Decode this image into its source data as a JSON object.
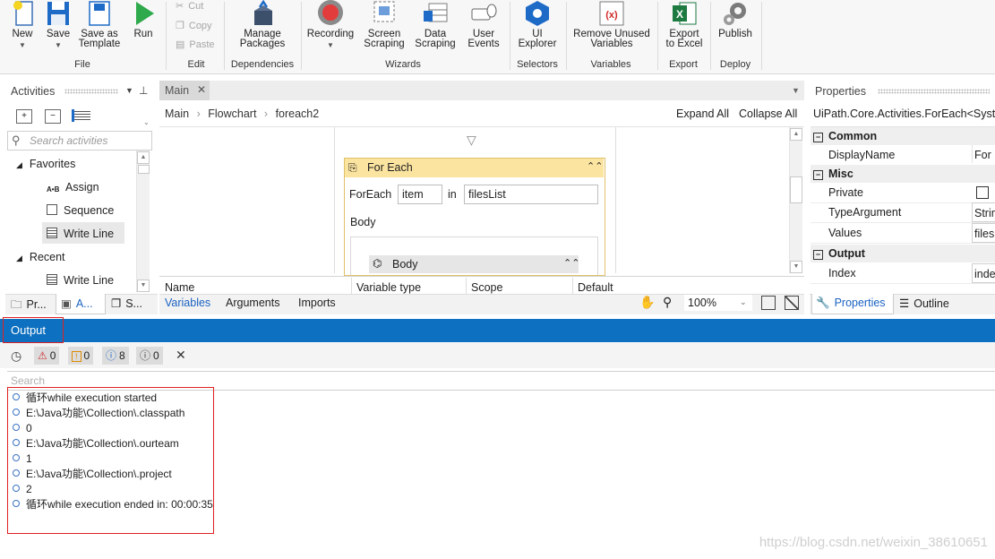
{
  "ribbon": {
    "buttons": {
      "new": "New",
      "save": "Save",
      "save_as_template_1": "Save as",
      "save_as_template_2": "Template",
      "run": "Run",
      "cut": "Cut",
      "copy": "Copy",
      "paste": "Paste",
      "manage_packages_1": "Manage",
      "manage_packages_2": "Packages",
      "recording": "Recording",
      "screen_scraping_1": "Screen",
      "screen_scraping_2": "Scraping",
      "data_scraping_1": "Data",
      "data_scraping_2": "Scraping",
      "user_events_1": "User",
      "user_events_2": "Events",
      "ui_explorer_1": "UI",
      "ui_explorer_2": "Explorer",
      "remove_unused_1": "Remove Unused",
      "remove_unused_2": "Variables",
      "export_excel_1": "Export",
      "export_excel_2": "to Excel",
      "publish": "Publish"
    },
    "groups": {
      "file": "File",
      "edit": "Edit",
      "dependencies": "Dependencies",
      "wizards": "Wizards",
      "selectors": "Selectors",
      "variables": "Variables",
      "export": "Export",
      "deploy": "Deploy"
    }
  },
  "activities": {
    "title": "Activities",
    "search_placeholder": "Search activities",
    "favorites_label": "Favorites",
    "favorites": [
      "Assign",
      "Sequence",
      "Write Line"
    ],
    "recent_label": "Recent",
    "recent": [
      "Write Line"
    ],
    "bottom_tabs": [
      "Pr...",
      "A...",
      "S..."
    ]
  },
  "designer": {
    "tab": "Main",
    "breadcrumb": [
      "Main",
      "Flowchart",
      "foreach2"
    ],
    "expand_all": "Expand All",
    "collapse_all": "Collapse All",
    "foreach": {
      "title": "For Each",
      "foreach_label": "ForEach",
      "item": "item",
      "in_label": "in",
      "collection": "filesList",
      "body_label": "Body",
      "body_block": "Body"
    },
    "var_columns": [
      "Name",
      "Variable type",
      "Scope",
      "Default"
    ],
    "bottom_tabs": [
      "Variables",
      "Arguments",
      "Imports"
    ],
    "zoom": "100%"
  },
  "properties": {
    "title": "Properties",
    "type": "UiPath.Core.Activities.ForEach<Syst",
    "categories": {
      "common": "Common",
      "misc": "Misc",
      "output": "Output"
    },
    "rows": {
      "display_name": {
        "label": "DisplayName",
        "value": "For I"
      },
      "private": {
        "label": "Private",
        "value": ""
      },
      "type_argument": {
        "label": "TypeArgument",
        "value": "Strin"
      },
      "values": {
        "label": "Values",
        "value": "files"
      },
      "index": {
        "label": "Index",
        "value": "inde"
      }
    },
    "bottom_tabs": [
      "Properties",
      "Outline"
    ]
  },
  "output": {
    "title": "Output",
    "error_count": "0",
    "warning_count": "0",
    "info_count": "8",
    "trace_count": "0",
    "search_placeholder": "Search",
    "lines": [
      "循环while execution started",
      "E:\\Java功能\\Collection\\.classpath",
      "0",
      "E:\\Java功能\\Collection\\.ourteam",
      "1",
      "E:\\Java功能\\Collection\\.project",
      "2",
      "循环while execution ended in: 00:00:35"
    ]
  },
  "watermark": "https://blog.csdn.net/weixin_38610651",
  "colors": {
    "accent_blue": "#0e70c0",
    "foreach_header": "#fbe4a0",
    "highlight_red": "#e02020"
  }
}
